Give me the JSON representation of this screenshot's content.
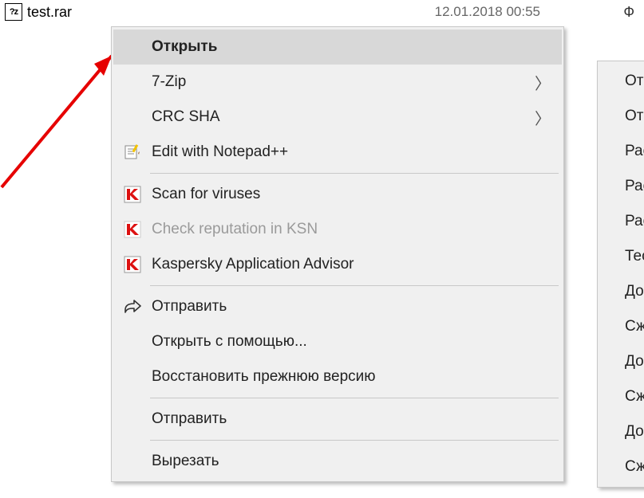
{
  "file": {
    "name": "test.rar",
    "date": "12.01.2018 00:55",
    "trailing_letter": "Ф"
  },
  "menu": {
    "open": "Открыть",
    "sevenzip": "7-Zip",
    "crcsha": "CRC SHA",
    "edit_notepadpp": "Edit with Notepad++",
    "scan_viruses": "Scan for viruses",
    "check_ksn": "Check reputation in KSN",
    "kaspersky_advisor": "Kaspersky Application Advisor",
    "send_share": "Отправить",
    "open_with": "Открыть с помощью...",
    "restore_previous": "Восстановить прежнюю версию",
    "send_to": "Отправить",
    "cut": "Вырезать"
  },
  "submenu": {
    "items": [
      "Отк",
      "Отк",
      "Рас",
      "Рас",
      "Рас",
      "Тес",
      "Доб",
      "Сж",
      "Доб",
      "Сж",
      "Доб",
      "Сж"
    ]
  }
}
